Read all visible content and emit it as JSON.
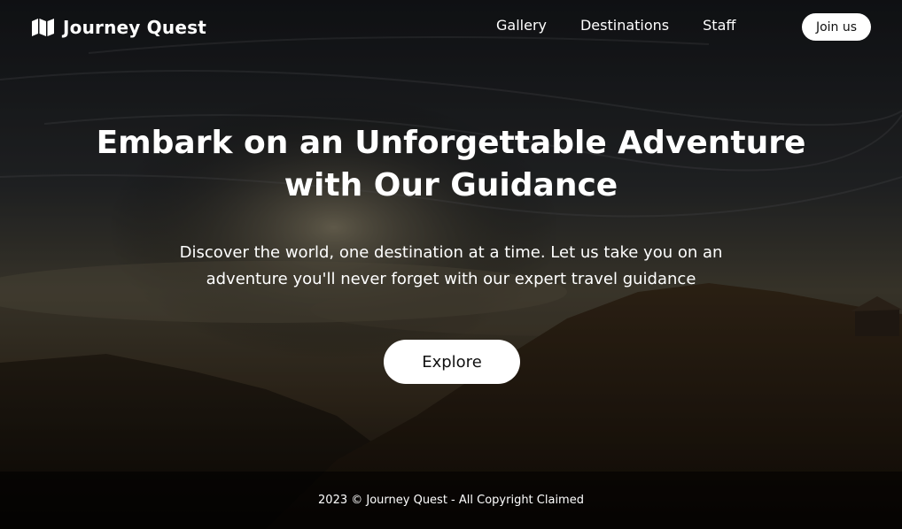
{
  "header": {
    "brand_name": "Journey Quest",
    "brand_icon": "map-icon",
    "nav": [
      {
        "label": "Gallery"
      },
      {
        "label": "Destinations"
      },
      {
        "label": "Staff"
      }
    ],
    "join_label": "Join us"
  },
  "hero": {
    "title_line1": "Embark on an Unforgettable Adventure",
    "title_line2": "with Our Guidance",
    "subtitle_line1": "Discover the world, one destination at a time. Let us take you on an",
    "subtitle_line2": "adventure you'll never forget with our expert travel guidance",
    "cta_label": "Explore"
  },
  "footer": {
    "text": "2023 © Journey Quest - All Copyright Claimed"
  },
  "colors": {
    "text": "#ffffff",
    "button_bg": "#ffffff",
    "button_text": "#111111",
    "background": "#0b0a09"
  }
}
